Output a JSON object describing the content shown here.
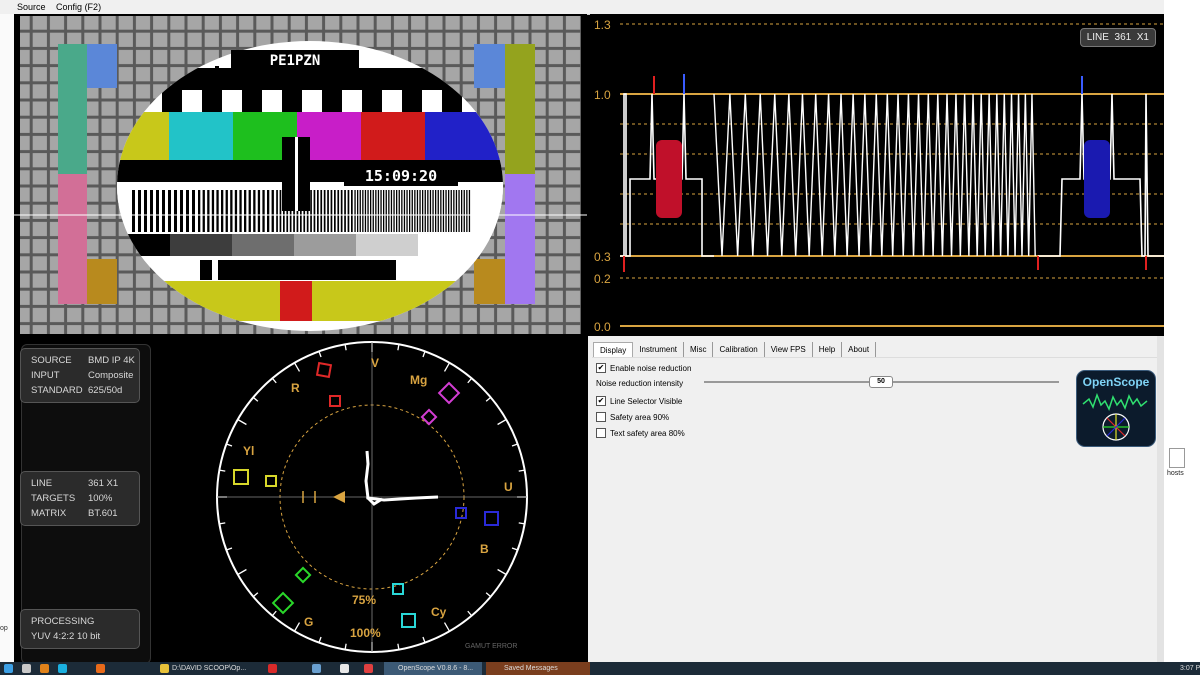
{
  "menubar": {
    "items": [
      "Source",
      "Config (F2)"
    ]
  },
  "picture": {
    "callsign": "PE1PZN",
    "clock": "15:09:20"
  },
  "waveform": {
    "badge_line_label": "LINE",
    "badge_line_value": "361",
    "badge_zoom": "X1",
    "scale_labels": [
      "1.3",
      "1.0",
      "0.3",
      "0.2",
      "0.0"
    ]
  },
  "info": {
    "source_card": [
      {
        "k": "SOURCE",
        "v": "BMD IP 4K"
      },
      {
        "k": "INPUT",
        "v": "Composite"
      },
      {
        "k": "STANDARD",
        "v": "625/50d"
      }
    ],
    "line_card": [
      {
        "k": "LINE",
        "v": "361  X1"
      },
      {
        "k": "TARGETS",
        "v": "100%"
      },
      {
        "k": "MATRIX",
        "v": "BT.601"
      }
    ],
    "processing_title": "PROCESSING",
    "processing_value": "YUV 4:2:2 10 bit"
  },
  "vectorscope": {
    "targets": [
      "V",
      "Mg",
      "R",
      "Yl",
      "U",
      "B",
      "G",
      "Cy"
    ],
    "pct_75": "75%",
    "pct_100": "100%",
    "gamut": "GAMUT ERROR"
  },
  "settings": {
    "tabs": [
      "Display",
      "Instrument",
      "Misc",
      "Calibration",
      "View FPS",
      "Help",
      "About"
    ],
    "active_tab": "Display",
    "enable_noise_reduction": "Enable noise reduction",
    "noise_reduction_intensity": "Noise reduction intensity",
    "noise_value": "50",
    "line_selector_visible": "Line Selector Visible",
    "safety_area": "Safety area 90%",
    "text_safety_area": "Text safety area 80%",
    "logo_text": "OpenScope"
  },
  "desktop": {
    "hosts_label": "hosts",
    "left_fragment": "op"
  },
  "taskbar": {
    "folder_item": "D:\\DAVID SCOOP\\Op...",
    "openscope_item": "OpenScope V0.8.6 - 8...",
    "messages_item": "Saved Messages",
    "clock": "3:07 P"
  },
  "colors": {
    "trace": "#ffffff",
    "graticule": "#d9a441",
    "accent_red": "#c0102a",
    "accent_blue": "#1a1ab0"
  }
}
